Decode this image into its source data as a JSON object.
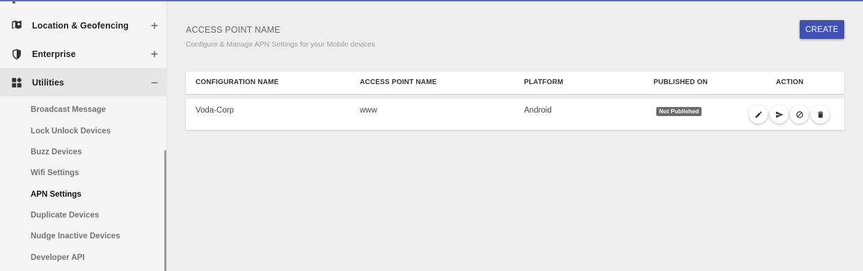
{
  "sidebar": {
    "items": [
      {
        "label": "Location & Geofencing",
        "icon": "map-pin-icon",
        "toggle": "+"
      },
      {
        "label": "Enterprise",
        "icon": "shield-icon",
        "toggle": "+"
      },
      {
        "label": "Utilities",
        "icon": "widgets-icon",
        "toggle": "−"
      }
    ],
    "subitems": [
      "Broadcast Message",
      "Lock Unlock Devices",
      "Buzz Devices",
      "Wifi Settings",
      "APN Settings",
      "Duplicate Devices",
      "Nudge Inactive Devices",
      "Developer API"
    ]
  },
  "main": {
    "title": "ACCESS POINT NAME",
    "subtitle": "Configure & Manage APN Settings for your Mobile devices",
    "create_label": "CREATE",
    "table": {
      "headers": [
        "CONFIGURATION NAME",
        "ACCESS POINT NAME",
        "PLATFORM",
        "PUBLISHED ON",
        "ACTION"
      ],
      "rows": [
        {
          "configuration_name": "Voda-Corp",
          "access_point_name": "www",
          "platform": "Android",
          "published_on": "Not Published"
        }
      ],
      "actions": [
        "edit-icon",
        "send-icon",
        "block-icon",
        "delete-icon"
      ]
    }
  },
  "colors": {
    "accent": "#3f51b5",
    "badge": "#6b6b6b",
    "sidebar_bg": "#f5f5f5",
    "page_bg": "#eeeeee"
  }
}
